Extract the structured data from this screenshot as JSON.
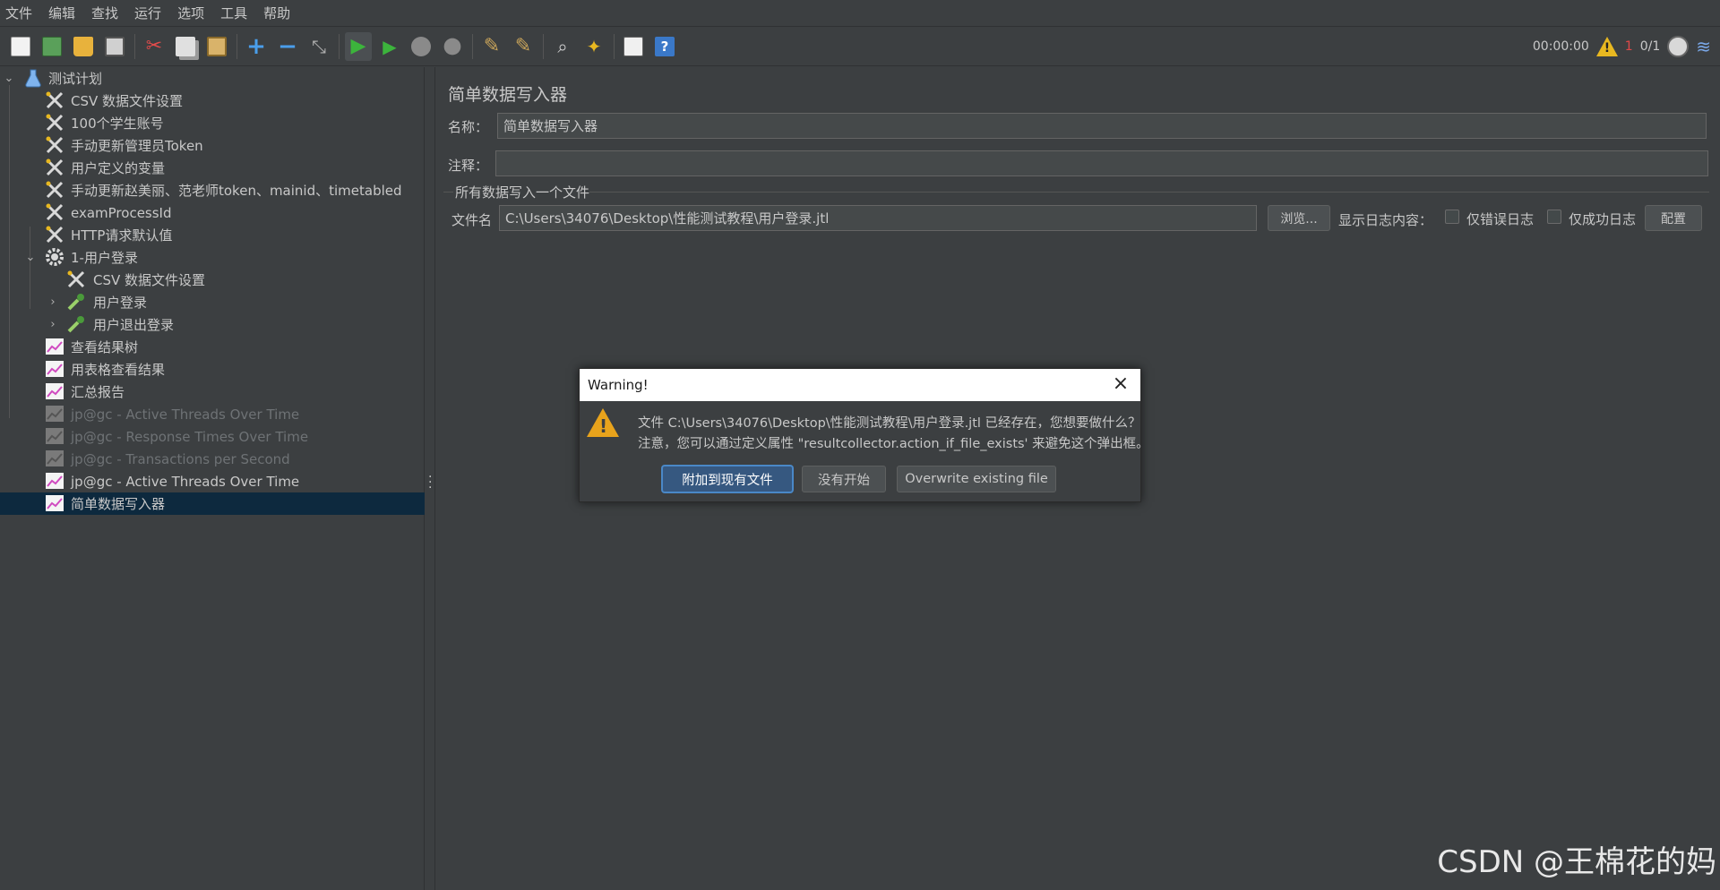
{
  "menu": [
    "文件",
    "编辑",
    "查找",
    "运行",
    "选项",
    "工具",
    "帮助"
  ],
  "toolbar": {
    "timer": "00:00:00",
    "error_count": "1",
    "threads": "0/1",
    "icons": [
      "new-icon",
      "templates-icon",
      "open-icon",
      "save-icon",
      "cut-icon",
      "copy-icon",
      "paste-icon",
      "expand-icon",
      "collapse-icon",
      "toggle-icon",
      "start-icon",
      "start-no-pause-icon",
      "stop-icon",
      "shutdown-icon",
      "clear-icon",
      "clear-all-icon",
      "search-icon",
      "reset-search-icon",
      "function-helper-icon",
      "help-icon"
    ]
  },
  "tree": {
    "items": [
      {
        "label": "测试计划",
        "icon": "flask-icon"
      },
      {
        "label": "CSV 数据文件设置",
        "icon": "config-icon"
      },
      {
        "label": "100个学生账号",
        "icon": "config-icon"
      },
      {
        "label": "手动更新管理员Token",
        "icon": "config-icon"
      },
      {
        "label": "用户定义的变量",
        "icon": "config-icon"
      },
      {
        "label": "手动更新赵美丽、范老师token、mainid、timetabled",
        "icon": "config-icon"
      },
      {
        "label": "examProcessId",
        "icon": "config-icon"
      },
      {
        "label": "HTTP请求默认值",
        "icon": "config-icon"
      },
      {
        "label": "1-用户登录",
        "icon": "gear-icon"
      },
      {
        "label": "CSV 数据文件设置",
        "icon": "config-icon"
      },
      {
        "label": "用户登录",
        "icon": "sampler-icon"
      },
      {
        "label": "用户退出登录",
        "icon": "sampler-icon"
      },
      {
        "label": "查看结果树",
        "icon": "listener-icon"
      },
      {
        "label": "用表格查看结果",
        "icon": "listener-icon"
      },
      {
        "label": "汇总报告",
        "icon": "listener-icon"
      },
      {
        "label": "jp@gc - Active Threads Over Time",
        "icon": "listener-icon"
      },
      {
        "label": "jp@gc - Response Times Over Time",
        "icon": "listener-icon"
      },
      {
        "label": "jp@gc - Transactions per Second",
        "icon": "listener-icon"
      },
      {
        "label": "jp@gc - Active Threads Over Time",
        "icon": "listener-icon"
      },
      {
        "label": "简单数据写入器",
        "icon": "listener-icon"
      }
    ]
  },
  "main": {
    "title": "简单数据写入器",
    "name_label": "名称：",
    "name_value": "简单数据写入器",
    "comment_label": "注释：",
    "comment_value": "",
    "group_title": "所有数据写入一个文件",
    "file_label": "文件名",
    "file_value": "C:\\Users\\34076\\Desktop\\性能测试教程\\用户登录.jtl",
    "browse_label": "浏览...",
    "log_label": "显示日志内容：",
    "errors_only_label": "仅错误日志",
    "success_only_label": "仅成功日志",
    "config_label": "配置"
  },
  "dialog": {
    "title": "Warning!",
    "line1": "文件 C:\\Users\\34076\\Desktop\\性能测试教程\\用户登录.jtl 已经存在，您想要做什么？",
    "line2": "注意，您可以通过定义属性 \"resultcollector.action_if_file_exists' 来避免这个弹出框。",
    "btn_append": "附加到现有文件",
    "btn_start": "没有开始",
    "btn_overwrite": "Overwrite existing file"
  },
  "watermark": "CSDN @王棉花的妈"
}
